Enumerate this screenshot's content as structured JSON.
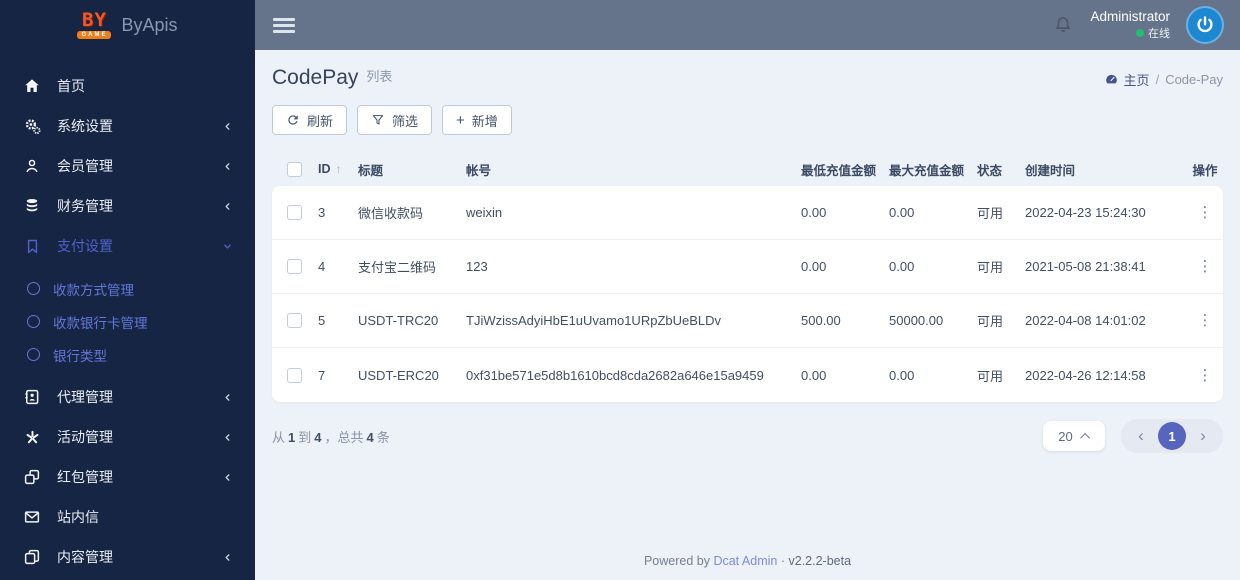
{
  "brand": {
    "logo_line1": "BY",
    "logo_line2": "GAME",
    "name": "ByApis"
  },
  "topbar": {
    "user": {
      "name": "Administrator",
      "status": "在线"
    }
  },
  "sidebar": {
    "items": [
      {
        "label": "首页",
        "icon": "home-icon"
      },
      {
        "label": "系统设置",
        "icon": "gears-icon",
        "chevron": "left"
      },
      {
        "label": "会员管理",
        "icon": "user-icon",
        "chevron": "left"
      },
      {
        "label": "财务管理",
        "icon": "database-icon",
        "chevron": "left"
      },
      {
        "label": "支付设置",
        "icon": "bookmark-icon",
        "chevron": "down",
        "active": true,
        "children": [
          {
            "label": "收款方式管理"
          },
          {
            "label": "收款银行卡管理"
          },
          {
            "label": "银行类型"
          }
        ]
      },
      {
        "label": "代理管理",
        "icon": "address-book-icon",
        "chevron": "left"
      },
      {
        "label": "活动管理",
        "icon": "burst-icon",
        "chevron": "left"
      },
      {
        "label": "红包管理",
        "icon": "clone-icon",
        "chevron": "left"
      },
      {
        "label": "站内信",
        "icon": "envelope-icon"
      },
      {
        "label": "内容管理",
        "icon": "copy-icon",
        "chevron": "left"
      }
    ]
  },
  "page": {
    "title": "CodePay",
    "subtitle": "列表",
    "breadcrumb": {
      "home": "主页",
      "separator": "/",
      "current": "Code-Pay"
    },
    "toolbar": {
      "refresh": "刷新",
      "filter": "筛选",
      "create": "新增",
      "create_icon": "+"
    }
  },
  "table": {
    "headers": {
      "id": "ID",
      "sort": "↑",
      "title": "标题",
      "account": "帐号",
      "min": "最低充值金额",
      "max": "最大充值金额",
      "status": "状态",
      "created": "创建时间",
      "actions": "操作"
    },
    "rows": [
      {
        "id": "3",
        "title": "微信收款码",
        "account": "weixin",
        "min": "0.00",
        "max": "0.00",
        "status": "可用",
        "created": "2022-04-23 15:24:30",
        "actions": "⋮"
      },
      {
        "id": "4",
        "title": "支付宝二维码",
        "account": "123",
        "min": "0.00",
        "max": "0.00",
        "status": "可用",
        "created": "2021-05-08 21:38:41",
        "actions": "⋮"
      },
      {
        "id": "5",
        "title": "USDT-TRC20",
        "account": "TJiWzissAdyiHbE1uUvamo1URpZbUeBLDv",
        "min": "500.00",
        "max": "50000.00",
        "status": "可用",
        "created": "2022-04-08 14:01:02",
        "actions": "⋮"
      },
      {
        "id": "7",
        "title": "USDT-ERC20",
        "account": "0xf31be571e5d8b1610bcd8cda2682a646e15a9459",
        "min": "0.00",
        "max": "0.00",
        "status": "可用",
        "created": "2022-04-26 12:14:58",
        "actions": "⋮"
      }
    ]
  },
  "pagination": {
    "summary": {
      "p1": "从",
      "from": "1",
      "p2": "到",
      "to": "4",
      "p3": "，总共",
      "total": "4",
      "p4": "条"
    },
    "per_page": "20",
    "prev": "‹",
    "page": "1",
    "next": "›"
  },
  "footer": {
    "powered": "Powered by",
    "link": "Dcat Admin",
    "dot": "·",
    "version": "v2.2.2-beta"
  },
  "colors": {
    "primary": "#5665bd",
    "sidebar_bg": "#162543",
    "topbar_bg": "#66748b",
    "status_online": "#20c06d"
  }
}
